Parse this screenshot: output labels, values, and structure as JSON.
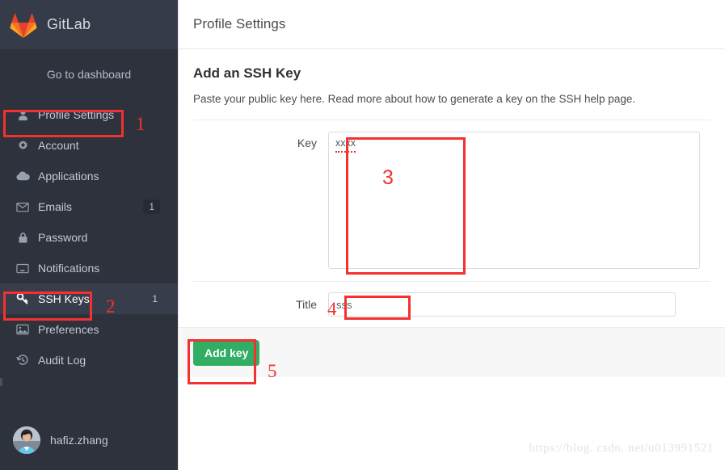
{
  "brand": {
    "name": "GitLab",
    "logo_icon": "gitlab-fox-logo"
  },
  "sidebar": {
    "dashboard_link": "Go to dashboard",
    "items": [
      {
        "label": "Profile Settings",
        "icon": "user-icon",
        "badge": "",
        "active": false
      },
      {
        "label": "Account",
        "icon": "gear-icon",
        "badge": "",
        "active": false
      },
      {
        "label": "Applications",
        "icon": "cloud-icon",
        "badge": "",
        "active": false
      },
      {
        "label": "Emails",
        "icon": "envelope-icon",
        "badge": "1",
        "active": false
      },
      {
        "label": "Password",
        "icon": "lock-icon",
        "badge": "",
        "active": false
      },
      {
        "label": "Notifications",
        "icon": "inbox-icon",
        "badge": "",
        "active": false
      },
      {
        "label": "SSH Keys",
        "icon": "key-icon",
        "badge": "1",
        "active": true
      },
      {
        "label": "Preferences",
        "icon": "image-icon",
        "badge": "",
        "active": false
      },
      {
        "label": "Audit Log",
        "icon": "history-clock-icon",
        "badge": "",
        "active": false
      }
    ],
    "user": {
      "name": "hafiz.zhang",
      "avatar_icon": "user-photo-avatar"
    }
  },
  "topbar": {
    "title": "Profile Settings"
  },
  "main": {
    "heading": "Add an SSH Key",
    "description": "Paste your public key here. Read more about how to generate a key on the SSH help page.",
    "key_field": {
      "label": "Key",
      "value": "xxxx"
    },
    "title_field": {
      "label": "Title",
      "value": "sss"
    },
    "submit_button": "Add key"
  },
  "annotations": {
    "markers": [
      "1",
      "2",
      "3",
      "4",
      "5"
    ],
    "color": "#f43030"
  },
  "watermark": "https://blog. csdn. net/u013991521"
}
